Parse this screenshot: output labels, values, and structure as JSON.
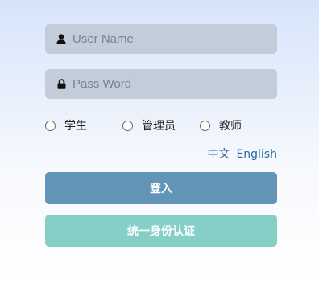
{
  "form": {
    "username": {
      "placeholder": "User Name",
      "value": "",
      "icon": "user-icon"
    },
    "password": {
      "placeholder": "Pass Word",
      "value": "",
      "icon": "lock-icon"
    }
  },
  "roles": [
    {
      "label": "学生",
      "selected": false
    },
    {
      "label": "管理员",
      "selected": false
    },
    {
      "label": "教师",
      "selected": false
    }
  ],
  "language": {
    "chinese": "中文",
    "english": "English"
  },
  "buttons": {
    "login": "登入",
    "sso": "统一身份认证"
  },
  "colors": {
    "login_button": "#6194b7",
    "sso_button": "#86cfc6",
    "field_bg": "#c3ccd9",
    "link": "#2a6a9c"
  }
}
